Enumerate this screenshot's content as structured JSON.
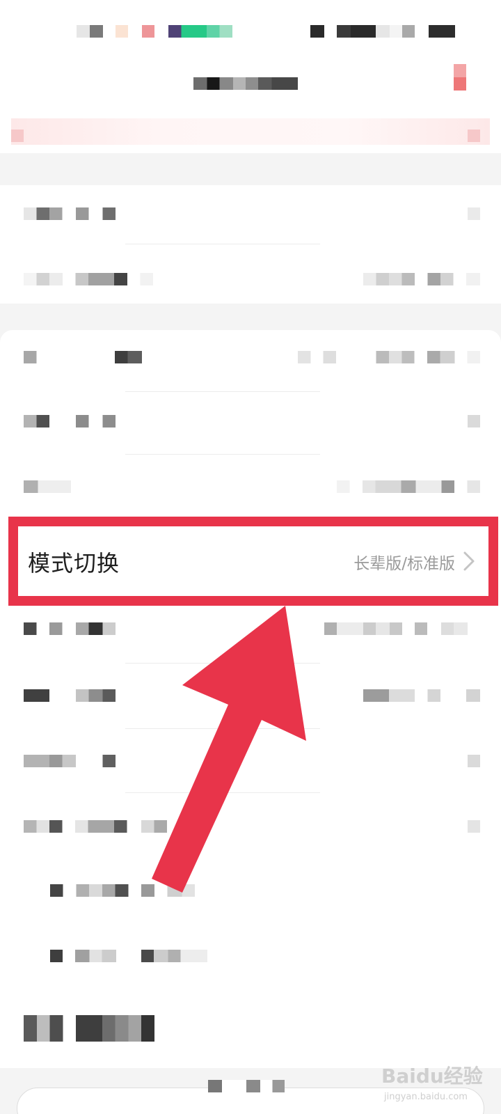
{
  "mode_switch": {
    "label": "模式切换",
    "value": "长辈版/标准版"
  },
  "watermark": {
    "text": "Baidu经验",
    "sub": "jingyan.baidu.com"
  },
  "icons": {
    "chevron": "chevron-right-icon",
    "arrow": "annotation-arrow-icon"
  },
  "colors": {
    "highlight": "#e8344a",
    "accent_pink": "#f08080",
    "status_green": "#2ecf8a"
  }
}
